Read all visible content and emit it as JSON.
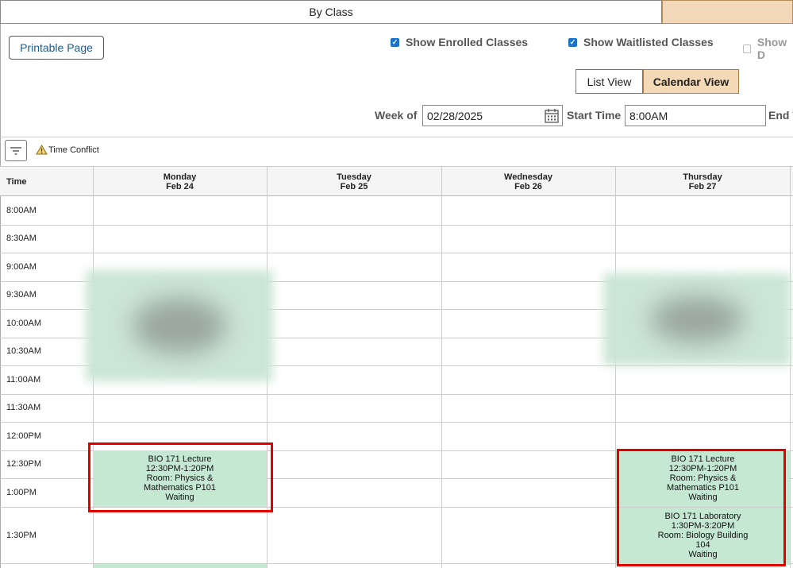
{
  "tabs": {
    "by_class": "By Class"
  },
  "toolbar": {
    "printable_page": "Printable Page"
  },
  "checkboxes": [
    {
      "label": "Show Enrolled Classes",
      "checked": true
    },
    {
      "label": "Show Waitlisted Classes",
      "checked": true
    },
    {
      "label": "Show D",
      "checked": false,
      "disabled": true
    }
  ],
  "views": {
    "list": "List View",
    "calendar": "Calendar View",
    "active": "Calendar View"
  },
  "filters": {
    "week_of_label": "Week of",
    "week_of_value": "02/28/2025",
    "start_time_label": "Start Time",
    "start_time_value": "8:00AM",
    "end_time_label": "End T"
  },
  "legend": {
    "time_conflict": "Time Conflict"
  },
  "calendar": {
    "time_header": "Time",
    "days": [
      {
        "name": "Monday",
        "date": "Feb 24"
      },
      {
        "name": "Tuesday",
        "date": "Feb 25"
      },
      {
        "name": "Wednesday",
        "date": "Feb 26"
      },
      {
        "name": "Thursday",
        "date": "Feb 27"
      }
    ],
    "times": [
      "8:00AM",
      "8:30AM",
      "9:00AM",
      "9:30AM",
      "10:00AM",
      "10:30AM",
      "11:00AM",
      "11:30AM",
      "12:00PM",
      "12:30PM",
      "1:00PM",
      "1:30PM"
    ],
    "events": {
      "mon_lecture": {
        "title": "BIO 171 Lecture",
        "time": "12:30PM-1:20PM",
        "room1": "Room: Physics &",
        "room2": "Mathematics P101",
        "status": "Waiting"
      },
      "thu_lecture": {
        "title": "BIO 171 Lecture",
        "time": "12:30PM-1:20PM",
        "room1": "Room: Physics &",
        "room2": "Mathematics P101",
        "status": "Waiting"
      },
      "thu_lab": {
        "title": "BIO 171 Laboratory",
        "time": "1:30PM-3:20PM",
        "room1": "Room: Biology Building",
        "room2": "104",
        "status": "Waiting"
      }
    }
  },
  "colors": {
    "event_bg": "#c5e8d3",
    "highlight": "#e00000",
    "active_view_bg": "#f4d9b6",
    "link": "#1d5c8c"
  }
}
